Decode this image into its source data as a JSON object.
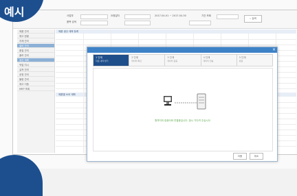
{
  "badge": {
    "label": "예시"
  },
  "filters": {
    "label_1": "사업부",
    "label_2": "품목 검색",
    "label_3": "요청일자",
    "label_4": "기간 조회",
    "date_range": "2017-04-01 ~ 2017-04-30",
    "search_label": "검색"
  },
  "sidebar": {
    "items": [
      "제품 관리",
      "재고 현황",
      "자재 관리",
      "설비 관리",
      "품질 관리",
      "출하 관리",
      "생산 계획",
      "작업 지시",
      "실적 관리",
      "공정 관리",
      "불량 관리",
      "재고 이동",
      "MRP 조회"
    ]
  },
  "sections": {
    "top": "제품 생산 계획 등록",
    "bottom": "제품별 소요 계획"
  },
  "modal": {
    "steps": [
      {
        "title": "1 단계",
        "sub": "자료 내려 받기"
      },
      {
        "title": "2 단계",
        "sub": "데이터 확인"
      },
      {
        "title": "3 단계",
        "sub": "데이터 검증"
      },
      {
        "title": "4 단계",
        "sub": "데이터 전송"
      },
      {
        "title": "5 단계",
        "sub": "완료"
      }
    ],
    "message": "원격지의 컴퓨터와 연결중입니다. 잠시 기다려 주십시오.",
    "confirm_label": "다음",
    "cancel_label": "취소"
  }
}
